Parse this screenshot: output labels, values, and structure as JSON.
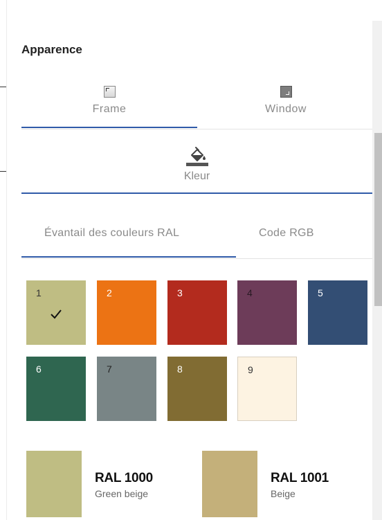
{
  "panel": {
    "title": "Apparence"
  },
  "part_tabs": [
    {
      "label": "Frame",
      "icon": "frame-thumbnail-icon"
    },
    {
      "label": "Window",
      "icon": "window-thumbnail-icon"
    }
  ],
  "color_tab": {
    "label": "Kleur",
    "icon": "paint-bucket-icon"
  },
  "subtabs": [
    {
      "label": "Évantail des couleurs RAL"
    },
    {
      "label": "Code RGB"
    }
  ],
  "swatches": [
    {
      "num": "1",
      "color": "#bfbd83",
      "text_color": "#333333",
      "selected": true
    },
    {
      "num": "2",
      "color": "#ec7314",
      "text_color": "#ffffff",
      "selected": false
    },
    {
      "num": "3",
      "color": "#b32b1e",
      "text_color": "#ffffff",
      "selected": false
    },
    {
      "num": "4",
      "color": "#6d3c59",
      "text_color": "#2a1a24",
      "selected": false
    },
    {
      "num": "5",
      "color": "#334e74",
      "text_color": "#ffffff",
      "selected": false
    },
    {
      "num": "6",
      "color": "#2f6650",
      "text_color": "#ffffff",
      "selected": false
    },
    {
      "num": "7",
      "color": "#798586",
      "text_color": "#222222",
      "selected": false
    },
    {
      "num": "8",
      "color": "#816c33",
      "text_color": "#ffffff",
      "selected": false
    },
    {
      "num": "9",
      "color": "#fdf3e2",
      "text_color": "#333333",
      "selected": false
    }
  ],
  "results": [
    {
      "code": "RAL 1000",
      "name": "Green beige",
      "color": "#bfbd83"
    },
    {
      "code": "RAL 1001",
      "name": "Beige",
      "color": "#c4b07a"
    }
  ],
  "accent_color": "#2f5aa8"
}
